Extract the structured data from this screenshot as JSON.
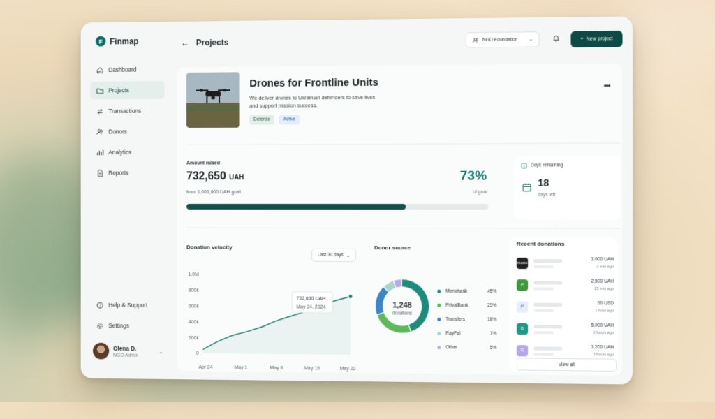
{
  "app": {
    "name": "Finmap",
    "logo_letter": "F"
  },
  "sidebar": {
    "items": [
      {
        "label": "Dashboard",
        "icon": "home-icon"
      },
      {
        "label": "Projects",
        "icon": "folder-icon",
        "active": true
      },
      {
        "label": "Transactions",
        "icon": "transactions-icon"
      },
      {
        "label": "Donors",
        "icon": "users-icon"
      },
      {
        "label": "Analytics",
        "icon": "bar-chart-icon"
      },
      {
        "label": "Reports",
        "icon": "document-icon"
      }
    ],
    "bottom_items": [
      {
        "label": "Help & Support",
        "icon": "help-icon"
      },
      {
        "label": "Settings",
        "icon": "gear-icon"
      }
    ],
    "user": {
      "name": "Olena D.",
      "role": "NGO Admin"
    }
  },
  "header": {
    "title": "Projects",
    "org_select": "NGO Foundation",
    "new_button": "New project"
  },
  "project": {
    "title": "Drones for Frontline Units",
    "description": "We deliver drones to Ukrainian defenders to save lives and support mission success.",
    "tags": [
      "Defense",
      "Active"
    ]
  },
  "funding": {
    "label": "Amount raised",
    "amount": "732,650",
    "unit": "UAH",
    "goal_text": "from 1,000,000 UAH goal",
    "percent": "73%",
    "percent_label": "of goal",
    "progress_fraction": 0.73
  },
  "days": {
    "label": "Days remaining",
    "value": "18",
    "sub": "days left"
  },
  "velocity": {
    "title": "Donation velocity",
    "range": "Last 30 days",
    "tooltip_value": "732,650 UAH",
    "tooltip_date": "May 24, 2024"
  },
  "donor_source": {
    "title": "Donor source",
    "center_value": "1,248",
    "center_label": "donations"
  },
  "recent": {
    "title": "Recent donations",
    "items": [
      {
        "amount": "1,000 UAH",
        "time": "2 min ago",
        "icon_label": "mono",
        "color": "#222222"
      },
      {
        "amount": "2,500 UAH",
        "time": "15 min ago",
        "icon_label": "P",
        "color": "#3c9a3a"
      },
      {
        "amount": "50 USD",
        "time": "1 hour ago",
        "icon_label": "P",
        "color": "#e7eefa"
      },
      {
        "amount": "5,000 UAH",
        "time": "2 hours ago",
        "icon_label": "B",
        "color": "#1c9a86"
      },
      {
        "amount": "1,200 UAH",
        "time": "3 hours ago",
        "icon_label": "G",
        "color": "#b7a7e8"
      }
    ],
    "view_all": "View all"
  },
  "colors": {
    "accent": "#0f6b62",
    "dark": "#0d4a45"
  },
  "chart_data": [
    {
      "type": "line",
      "title": "Donation velocity",
      "x": [
        "Apr 24",
        "Apr 27",
        "Apr 30",
        "May 3",
        "May 6",
        "May 9",
        "May 12",
        "May 15",
        "May 18",
        "May 21",
        "May 24"
      ],
      "x_ticks": [
        "Apr 24",
        "May 1",
        "May 8",
        "May 15",
        "May 22"
      ],
      "series": [
        {
          "values": [
            50000,
            150000,
            230000,
            280000,
            340000,
            420000,
            480000,
            540000,
            620000,
            680000,
            732650
          ]
        }
      ],
      "y_ticks": [
        "0",
        "200k",
        "400k",
        "600k",
        "800k",
        "1.0M"
      ],
      "ylim": [
        0,
        1000000
      ],
      "grid": false
    },
    {
      "type": "pie",
      "title": "Donor source",
      "categories": [
        "Monobank",
        "PrivatBank",
        "Transfers",
        "PayPal",
        "Other"
      ],
      "values": [
        45,
        25,
        18,
        7,
        5
      ],
      "value_labels": [
        "45%",
        "25%",
        "18%",
        "7%",
        "5%"
      ],
      "colors": [
        "#1e8a7c",
        "#5cba5a",
        "#3c86c8",
        "#a9d6cb",
        "#b9a9ea"
      ]
    }
  ]
}
